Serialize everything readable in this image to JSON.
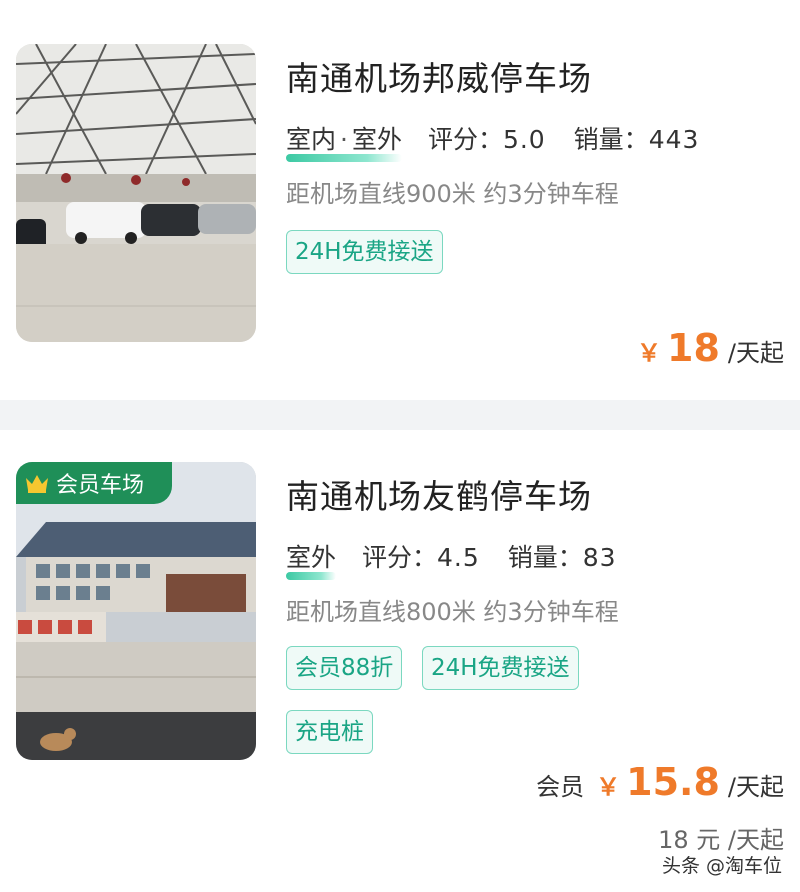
{
  "listings": [
    {
      "name": "南通机场邦威停车场",
      "types": [
        "室内",
        "室外"
      ],
      "type_separator": "·",
      "rating_label": "评分：",
      "rating": "5.0",
      "sales_label": "销量：",
      "sales": "443",
      "distance": "距机场直线900米 约3分钟车程",
      "tags": [
        "24H免费接送"
      ],
      "price_symbol": "￥",
      "price": "18",
      "price_unit": "/天起",
      "image": "canopy-parking-photo"
    },
    {
      "name": "南通机场友鹤停车场",
      "badge": "会员车场",
      "badge_icon": "crown-icon",
      "types": [
        "室外"
      ],
      "rating_label": "评分：",
      "rating": "4.5",
      "sales_label": "销量：",
      "sales": "83",
      "distance": "距机场直线800米 约3分钟车程",
      "tags": [
        "会员88折",
        "24H免费接送",
        "充电桩"
      ],
      "member_label": "会员",
      "price_symbol": "￥",
      "price": "15.8",
      "price_unit": "/天起",
      "original_price": "18 元 /天起",
      "image": "outdoor-lot-photo"
    }
  ],
  "watermark": "头条 @淘车位",
  "colors": {
    "accent_green": "#1aa585",
    "tag_border": "#7bd8c0",
    "price_orange": "#ef7a2a",
    "badge_green": "#1f8f58"
  }
}
